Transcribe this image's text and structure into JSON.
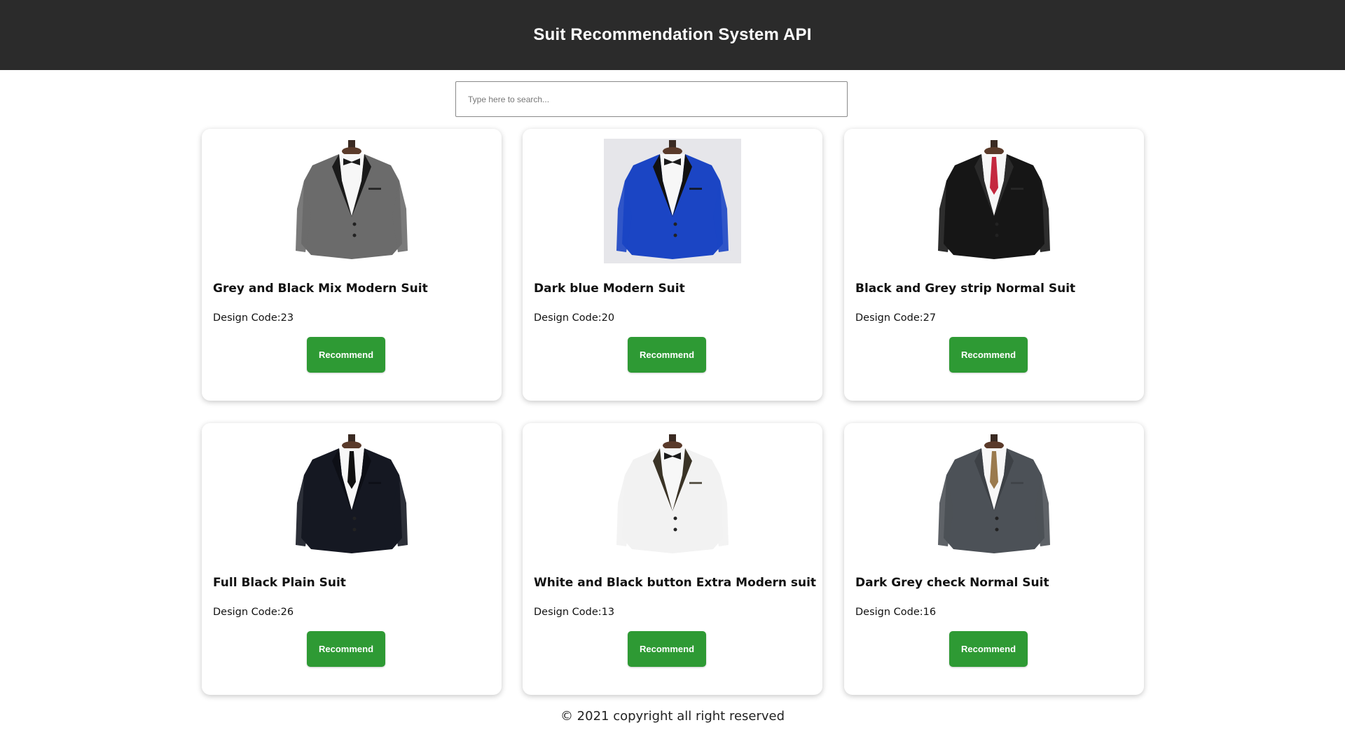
{
  "header": {
    "title": "Suit Recommendation System API"
  },
  "search": {
    "placeholder": "Type here to search..."
  },
  "cards": [
    {
      "title": "Grey and Black Mix Modern Suit",
      "code": "Design Code:23",
      "button": "Recommend",
      "jacket_color": "#6b6b6b",
      "lapel_color": "#1a1a1a",
      "bg": "#ffffff",
      "icon": "grey-suit-image"
    },
    {
      "title": "Dark blue Modern Suit",
      "code": "Design Code:20",
      "button": "Recommend",
      "jacket_color": "#1b45c4",
      "lapel_color": "#111111",
      "bg": "#e6e6ea",
      "icon": "blue-suit-image"
    },
    {
      "title": "Black and Grey strip Normal Suit",
      "code": "Design Code:27",
      "button": "Recommend",
      "jacket_color": "#161616",
      "lapel_color": "#2a2a2a",
      "bg": "#ffffff",
      "icon": "black-suit-image"
    },
    {
      "title": "Full Black Plain Suit",
      "code": "Design Code:26",
      "button": "Recommend",
      "jacket_color": "#151822",
      "lapel_color": "#0d0f16",
      "bg": "#ffffff",
      "icon": "black-plain-suit-image"
    },
    {
      "title": "White and Black button Extra Modern suit",
      "code": "Design Code:13",
      "button": "Recommend",
      "jacket_color": "#f2f2f2",
      "lapel_color": "#3a3326",
      "bg": "#ffffff",
      "icon": "white-suit-image"
    },
    {
      "title": "Dark Grey check Normal Suit",
      "code": "Design Code:16",
      "button": "Recommend",
      "jacket_color": "#4c5157",
      "lapel_color": "#3d4146",
      "bg": "#ffffff",
      "icon": "grey-check-suit-image"
    }
  ],
  "footer": {
    "text": "© 2021 copyright all right reserved"
  },
  "colors": {
    "header_bg": "#2b2b2b",
    "button_bg": "#2e9a34"
  }
}
